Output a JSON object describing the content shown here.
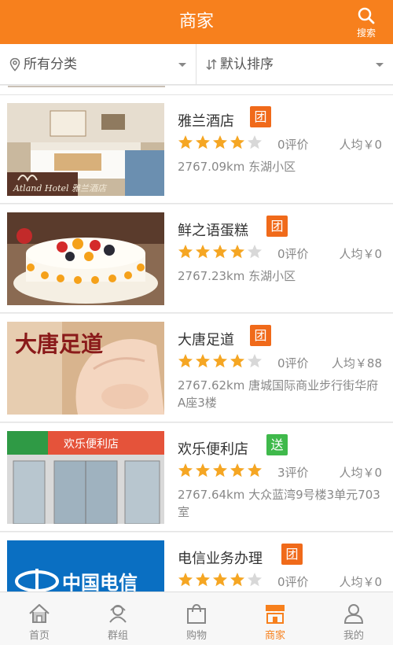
{
  "header": {
    "title": "商家",
    "search_label": "搜索"
  },
  "filters": {
    "category": "所有分类",
    "sort": "默认排序"
  },
  "colors": {
    "brand": "#f7801d",
    "tuan_badge": "#f06a1a",
    "song_badge": "#3fb94b",
    "star_on": "#f5a623",
    "star_off": "#d8d8d8"
  },
  "merchants": [
    {
      "name": "雅兰酒店",
      "badge": "团",
      "rating": 4,
      "reviews": "0评价",
      "avg": "人均￥0",
      "address": "2767.09km 东湖小区",
      "image_text": "Atland Hotel 雅兰酒店"
    },
    {
      "name": "鲜之语蛋糕",
      "badge": "团",
      "rating": 4,
      "reviews": "0评价",
      "avg": "人均￥0",
      "address": "2767.23km 东湖小区"
    },
    {
      "name": "大唐足道",
      "badge": "团",
      "rating": 4,
      "reviews": "0评价",
      "avg": "人均￥88",
      "address": "2767.62km 唐城国际商业步行街华府A座3楼",
      "image_text": "大唐足道"
    },
    {
      "name": "欢乐便利店",
      "badge": "送",
      "rating": 5,
      "reviews": "3评价",
      "avg": "人均￥0",
      "address": "2767.64km 大众蓝湾9号楼3单元703室",
      "image_text": "欢乐便利店"
    },
    {
      "name": "电信业务办理",
      "badge": "团",
      "rating": 4,
      "reviews": "0评价",
      "avg": "人均￥0",
      "address": "",
      "image_text": "中国电信"
    }
  ],
  "tabs": [
    {
      "label": "首页",
      "icon": "home-icon"
    },
    {
      "label": "群组",
      "icon": "group-icon"
    },
    {
      "label": "购物",
      "icon": "shopping-bag-icon"
    },
    {
      "label": "商家",
      "icon": "shop-icon",
      "active": true
    },
    {
      "label": "我的",
      "icon": "profile-icon"
    }
  ]
}
